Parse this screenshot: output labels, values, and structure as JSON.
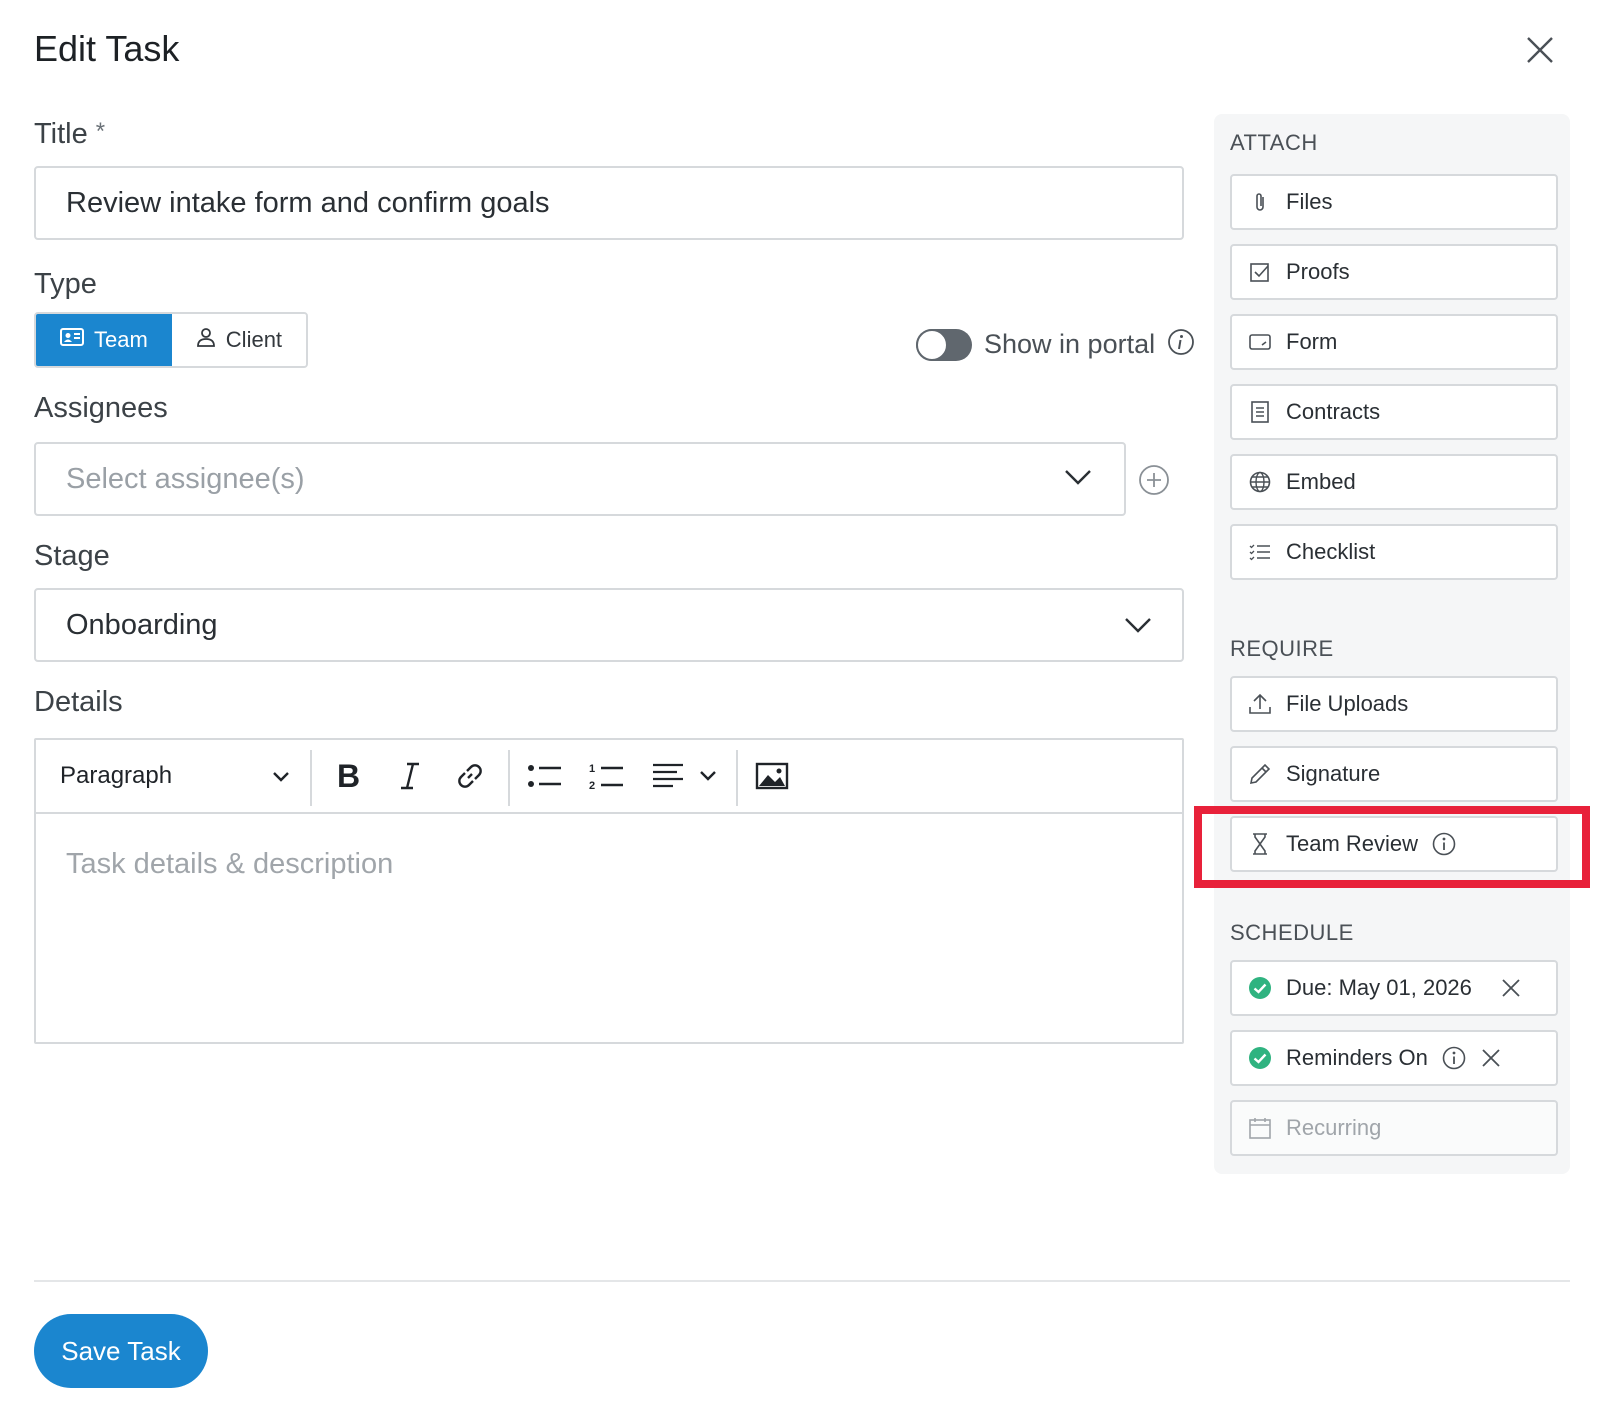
{
  "dialog": {
    "title": "Edit Task"
  },
  "form": {
    "title_label": "Title",
    "title_required_mark": "*",
    "title_value": "Review intake form and confirm goals",
    "type_label": "Type",
    "type_options": {
      "team": "Team",
      "client": "Client",
      "selected": "Team"
    },
    "show_in_portal_label": "Show in portal",
    "show_in_portal_on": false,
    "assignees_label": "Assignees",
    "assignees_placeholder": "Select assignee(s)",
    "stage_label": "Stage",
    "stage_value": "Onboarding",
    "details_label": "Details",
    "details_placeholder": "Task details & description",
    "paragraph_style": "Paragraph"
  },
  "sidebar": {
    "attach_heading": "ATTACH",
    "attach_items": [
      {
        "label": "Files",
        "icon": "paperclip-icon"
      },
      {
        "label": "Proofs",
        "icon": "checkbox-icon"
      },
      {
        "label": "Form",
        "icon": "form-icon"
      },
      {
        "label": "Contracts",
        "icon": "document-icon"
      },
      {
        "label": "Embed",
        "icon": "globe-icon"
      },
      {
        "label": "Checklist",
        "icon": "checklist-icon"
      }
    ],
    "require_heading": "REQUIRE",
    "require_items": [
      {
        "label": "File Uploads",
        "icon": "upload-icon"
      },
      {
        "label": "Signature",
        "icon": "pen-icon"
      },
      {
        "label": "Team Review",
        "icon": "hourglass-icon"
      }
    ],
    "schedule_heading": "SCHEDULE",
    "schedule_items": [
      {
        "label": "Due: May 01, 2026",
        "icon": "check-circle-icon"
      },
      {
        "label": "Reminders On",
        "icon": "check-circle-icon"
      },
      {
        "label": "Recurring",
        "icon": "calendar-icon"
      }
    ]
  },
  "footer": {
    "save_label": "Save Task"
  },
  "colors": {
    "accent": "#1b86cf",
    "success": "#2fb380",
    "highlight": "#e8213a"
  }
}
